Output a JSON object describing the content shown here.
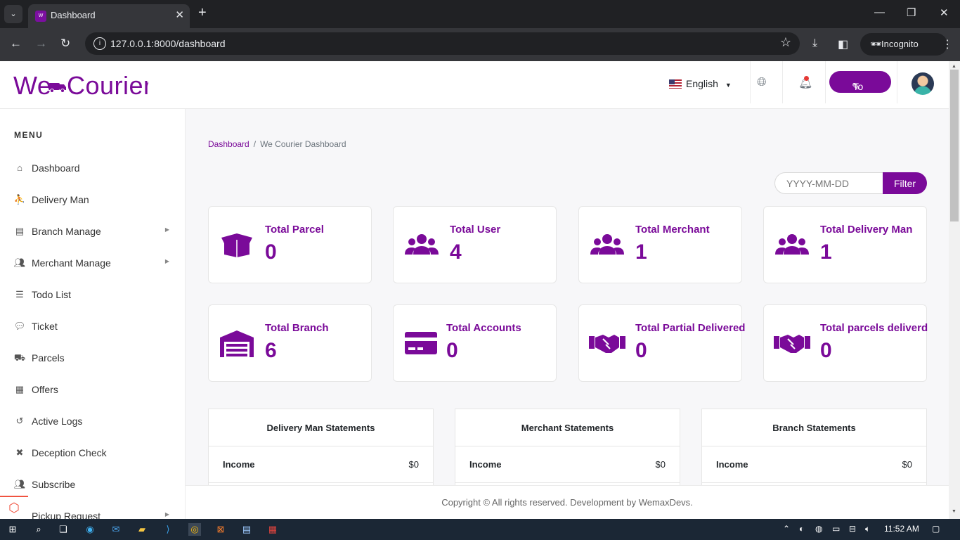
{
  "browser": {
    "tab_title": "Dashboard",
    "url": "127.0.0.1:8000/dashboard",
    "incognito_label": "Incognito"
  },
  "header": {
    "logo": "WeCourier",
    "language": "English",
    "todo_label": "To Do"
  },
  "sidebar": {
    "menu_title": "MENU",
    "items": [
      {
        "label": "Dashboard",
        "icon": "home-icon",
        "has_submenu": false
      },
      {
        "label": "Delivery Man",
        "icon": "people-carry-icon",
        "has_submenu": false
      },
      {
        "label": "Branch Manage",
        "icon": "warehouse-icon",
        "has_submenu": true
      },
      {
        "label": "Merchant Manage",
        "icon": "users-icon",
        "has_submenu": true
      },
      {
        "label": "Todo List",
        "icon": "list-check-icon",
        "has_submenu": false
      },
      {
        "label": "Ticket",
        "icon": "comments-icon",
        "has_submenu": false
      },
      {
        "label": "Parcels",
        "icon": "dolly-icon",
        "has_submenu": false
      },
      {
        "label": "Offers",
        "icon": "newspaper-icon",
        "has_submenu": false
      },
      {
        "label": "Active Logs",
        "icon": "history-icon",
        "has_submenu": false
      },
      {
        "label": "Deception Check",
        "icon": "user-times-icon",
        "has_submenu": false
      },
      {
        "label": "Subscribe",
        "icon": "users-icon",
        "has_submenu": false
      },
      {
        "label": "Pickup Request",
        "icon": "truck-icon",
        "has_submenu": true
      }
    ]
  },
  "breadcrumb": {
    "home": "Dashboard",
    "separator": "/",
    "current": "We Courier Dashboard"
  },
  "filter": {
    "placeholder": "YYYY-MM-DD",
    "button_label": "Filter"
  },
  "stats": [
    {
      "title": "Total Parcel",
      "value": "0",
      "icon": "box-open-icon"
    },
    {
      "title": "Total User",
      "value": "4",
      "icon": "users-icon"
    },
    {
      "title": "Total Merchant",
      "value": "1",
      "icon": "users-icon"
    },
    {
      "title": "Total Delivery Man",
      "value": "1",
      "icon": "users-icon"
    },
    {
      "title": "Total Branch",
      "value": "6",
      "icon": "warehouse-icon"
    },
    {
      "title": "Total Accounts",
      "value": "0",
      "icon": "credit-card-icon"
    },
    {
      "title": "Total Partial Delivered",
      "value": "0",
      "icon": "handshake-icon"
    },
    {
      "title": "Total parcels deliverd",
      "value": "0",
      "icon": "handshake-icon"
    }
  ],
  "statements": [
    {
      "title": "Delivery Man Statements",
      "row_label": "Income",
      "row_value": "$0"
    },
    {
      "title": "Merchant Statements",
      "row_label": "Income",
      "row_value": "$0"
    },
    {
      "title": "Branch Statements",
      "row_label": "Income",
      "row_value": "$0"
    }
  ],
  "footer": {
    "text": "Copyright © All rights reserved. Development by WemaxDevs."
  },
  "taskbar": {
    "time": "11:52 AM"
  },
  "colors": {
    "brand": "#7a0a99",
    "chrome_dark": "#202124",
    "chrome_mid": "#35363a",
    "taskbar": "#1b2735"
  }
}
